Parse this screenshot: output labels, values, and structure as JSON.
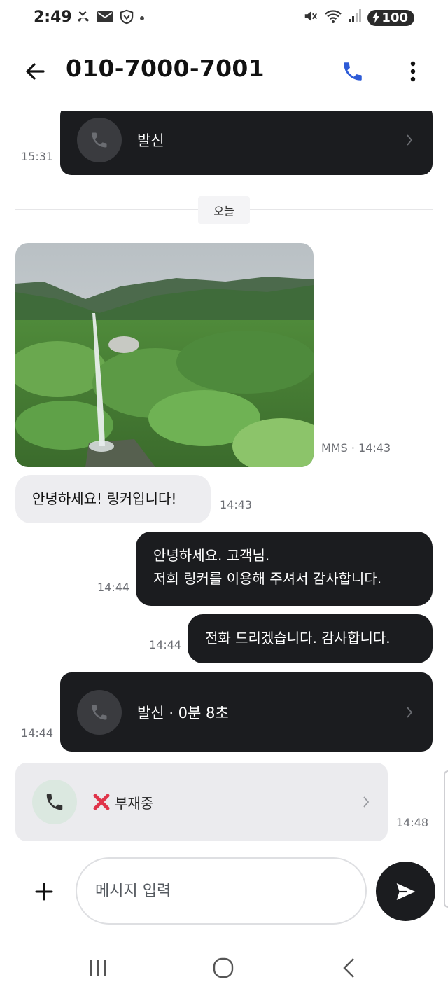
{
  "status_bar": {
    "time": "2:49",
    "notification_icons": [
      "missed-call-icon",
      "mail-icon",
      "shield-icon"
    ],
    "battery": "100"
  },
  "header": {
    "title": "010-7000-7001"
  },
  "messages": {
    "call_top": {
      "label": "발신",
      "time": "15:31"
    },
    "date_separator": "오늘",
    "photo": {
      "meta": "MMS · 14:43"
    },
    "incoming_1": {
      "text": "안녕하세요! 링커입니다!",
      "time": "14:43"
    },
    "outgoing_1": {
      "line1": "안녕하세요. 고객님.",
      "line2": "저희 링커를  이용해 주셔서 감사합니다.",
      "time": "14:44"
    },
    "outgoing_2": {
      "text": "전화 드리겠습니다. 감사합니다.",
      "time": "14:44"
    },
    "call_out": {
      "label": "발신 · 0분 8초",
      "time": "14:44"
    },
    "missed_call": {
      "label": "부재중",
      "time": "14:48"
    }
  },
  "composer": {
    "placeholder": "메시지 입력"
  },
  "colors": {
    "dark_bubble": "#1b1c1f",
    "light_bubble": "#ededf0",
    "call_icon_blue": "#2d5bd7",
    "missed_red": "#e0344a"
  }
}
